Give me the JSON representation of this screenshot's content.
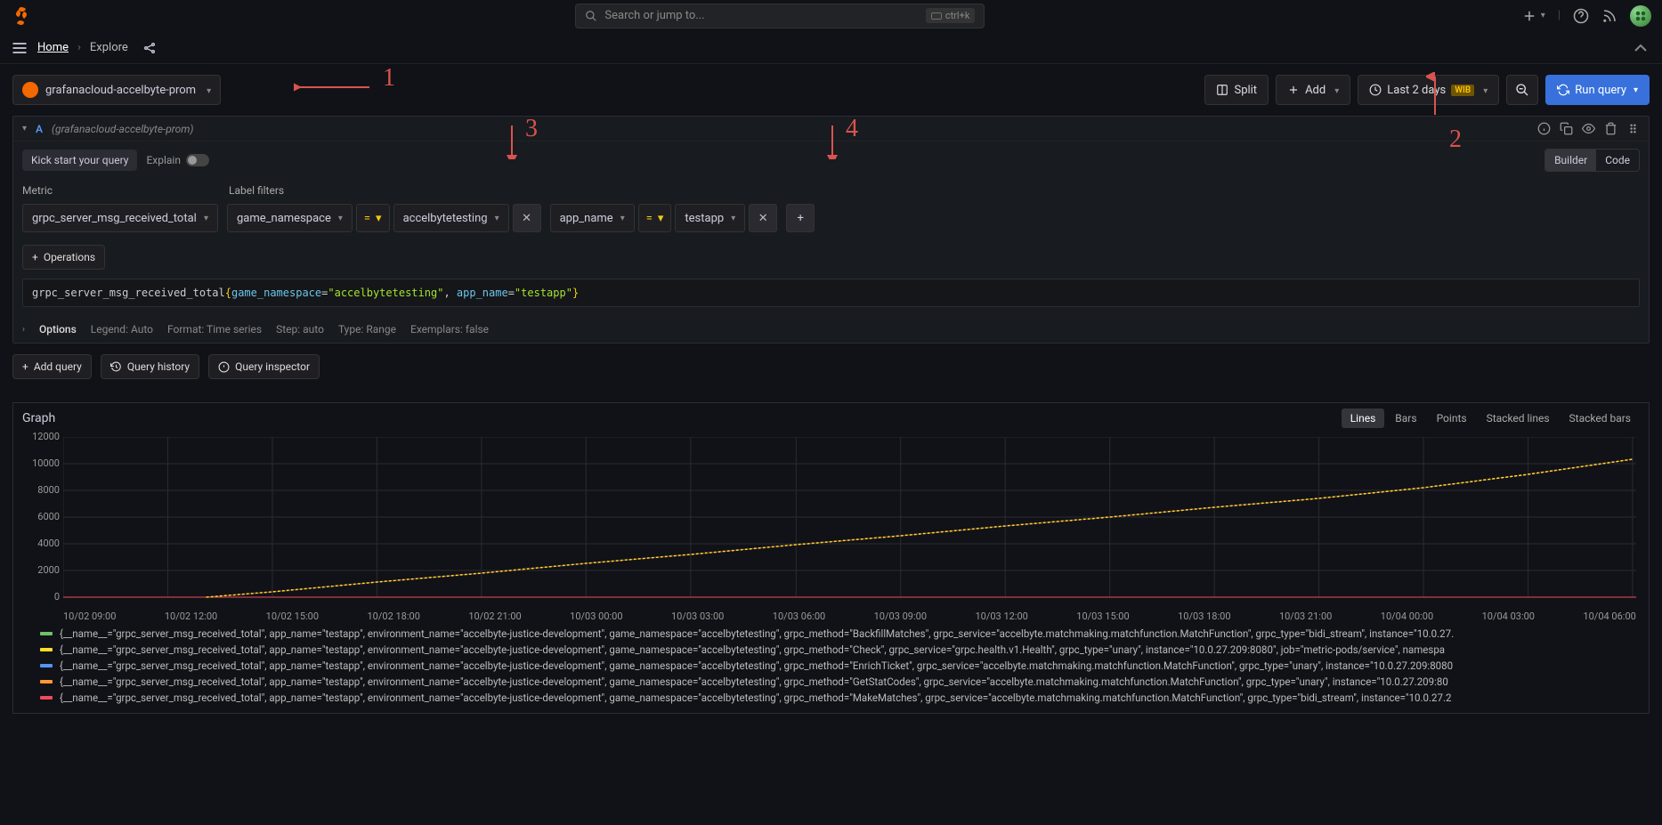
{
  "search": {
    "placeholder": "Search or jump to...",
    "shortcut": "ctrl+k"
  },
  "crumbs": {
    "home": "Home",
    "current": "Explore"
  },
  "datasource": {
    "name": "grafanacloud-accelbyte-prom"
  },
  "toolbar": {
    "split": "Split",
    "add": "Add",
    "timerange": "Last 2 days",
    "tz": "WIB",
    "run": "Run query"
  },
  "query": {
    "ref": "A",
    "dslabel": "(grafanacloud-accelbyte-prom)",
    "kick": "Kick start your query",
    "explain": "Explain",
    "builder": "Builder",
    "code": "Code",
    "metric_hdr": "Metric",
    "filter_hdr": "Label filters",
    "metric": "grpc_server_msg_received_total",
    "filters": [
      {
        "key": "game_namespace",
        "op": "=",
        "value": "accelbytetesting"
      },
      {
        "key": "app_name",
        "op": "=",
        "value": "testapp"
      }
    ],
    "operations": "Operations",
    "raw": {
      "metric": "grpc_server_msg_received_total",
      "k1": "game_namespace",
      "v1": "accelbytetesting",
      "k2": "app_name",
      "v2": "testapp"
    },
    "options": {
      "label": "Options",
      "legend": "Legend: Auto",
      "format": "Format: Time series",
      "step": "Step: auto",
      "type": "Type: Range",
      "exemplars": "Exemplars: false"
    }
  },
  "buttons": {
    "addquery": "Add query",
    "history": "Query history",
    "inspector": "Query inspector"
  },
  "graph": {
    "title": "Graph",
    "modes": [
      "Lines",
      "Bars",
      "Points",
      "Stacked lines",
      "Stacked bars"
    ],
    "yticks": [
      "12000",
      "10000",
      "8000",
      "6000",
      "4000",
      "2000",
      "0"
    ],
    "xticks": [
      "10/02 09:00",
      "10/02 12:00",
      "10/02 15:00",
      "10/02 18:00",
      "10/02 21:00",
      "10/03 00:00",
      "10/03 03:00",
      "10/03 06:00",
      "10/03 09:00",
      "10/03 12:00",
      "10/03 15:00",
      "10/03 18:00",
      "10/03 21:00",
      "10/04 00:00",
      "10/04 03:00",
      "10/04 06:00"
    ]
  },
  "legend": [
    {
      "color": "#73bf69",
      "text": "{__name__=\"grpc_server_msg_received_total\", app_name=\"testapp\", environment_name=\"accelbyte-justice-development\", game_namespace=\"accelbytetesting\", grpc_method=\"BackfillMatches\", grpc_service=\"accelbyte.matchmaking.matchfunction.MatchFunction\", grpc_type=\"bidi_stream\", instance=\"10.0.27."
    },
    {
      "color": "#fade2a",
      "text": "{__name__=\"grpc_server_msg_received_total\", app_name=\"testapp\", environment_name=\"accelbyte-justice-development\", game_namespace=\"accelbytetesting\", grpc_method=\"Check\", grpc_service=\"grpc.health.v1.Health\", grpc_type=\"unary\", instance=\"10.0.27.209:8080\", job=\"metric-pods/service\", namespa"
    },
    {
      "color": "#5794f2",
      "text": "{__name__=\"grpc_server_msg_received_total\", app_name=\"testapp\", environment_name=\"accelbyte-justice-development\", game_namespace=\"accelbytetesting\", grpc_method=\"EnrichTicket\", grpc_service=\"accelbyte.matchmaking.matchfunction.MatchFunction\", grpc_type=\"unary\", instance=\"10.0.27.209:8080"
    },
    {
      "color": "#ff9830",
      "text": "{__name__=\"grpc_server_msg_received_total\", app_name=\"testapp\", environment_name=\"accelbyte-justice-development\", game_namespace=\"accelbytetesting\", grpc_method=\"GetStatCodes\", grpc_service=\"accelbyte.matchmaking.matchfunction.MatchFunction\", grpc_type=\"unary\", instance=\"10.0.27.209:80"
    },
    {
      "color": "#f2495c",
      "text": "{__name__=\"grpc_server_msg_received_total\", app_name=\"testapp\", environment_name=\"accelbyte-justice-development\", game_namespace=\"accelbytetesting\", grpc_method=\"MakeMatches\", grpc_service=\"accelbyte.matchmaking.matchfunction.MatchFunction\", grpc_type=\"bidi_stream\", instance=\"10.0.27.2"
    }
  ],
  "annotations": {
    "a1": "1",
    "a2": "2",
    "a3": "3",
    "a4": "4"
  },
  "chart_data": {
    "type": "line",
    "title": "Graph",
    "xlabel": "",
    "ylabel": "",
    "ylim": [
      0,
      12000
    ],
    "x": [
      "10/02 09:00",
      "10/02 12:00",
      "10/02 15:00",
      "10/02 18:00",
      "10/02 21:00",
      "10/03 00:00",
      "10/03 03:00",
      "10/03 06:00",
      "10/03 09:00",
      "10/03 12:00",
      "10/03 15:00",
      "10/03 18:00",
      "10/03 21:00",
      "10/04 00:00",
      "10/04 03:00",
      "10/04 06:00"
    ],
    "series": [
      {
        "name": "BackfillMatches",
        "values": [
          0,
          0,
          0,
          0,
          0,
          0,
          0,
          0,
          0,
          0,
          0,
          0,
          0,
          0,
          0,
          0
        ]
      },
      {
        "name": "Check",
        "values": [
          0,
          0,
          400,
          1100,
          1800,
          2500,
          3200,
          3900,
          4600,
          5300,
          6000,
          6700,
          7400,
          8200,
          9200,
          10300
        ]
      },
      {
        "name": "EnrichTicket",
        "values": [
          0,
          0,
          0,
          0,
          0,
          0,
          0,
          0,
          0,
          0,
          0,
          0,
          0,
          0,
          0,
          0
        ]
      },
      {
        "name": "GetStatCodes",
        "values": [
          0,
          0,
          0,
          0,
          0,
          0,
          0,
          0,
          0,
          0,
          0,
          0,
          0,
          0,
          0,
          0
        ]
      },
      {
        "name": "MakeMatches",
        "values": [
          0,
          0,
          0,
          0,
          0,
          0,
          0,
          0,
          0,
          0,
          0,
          0,
          0,
          0,
          0,
          0
        ]
      }
    ]
  }
}
